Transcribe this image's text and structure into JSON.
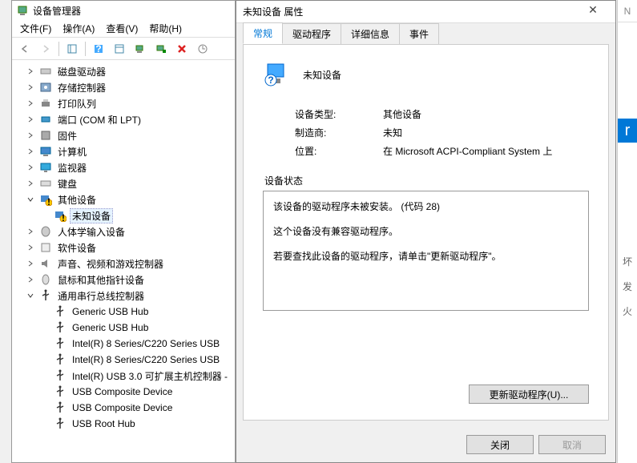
{
  "devmgr": {
    "title": "设备管理器",
    "menu": {
      "file": "文件(F)",
      "action": "操作(A)",
      "view": "查看(V)",
      "help": "帮助(H)"
    },
    "tree": [
      {
        "label": "磁盘驱动器",
        "icon": "disk-icon",
        "expander": ">",
        "indent": 1
      },
      {
        "label": "存储控制器",
        "icon": "storage-icon",
        "expander": ">",
        "indent": 1
      },
      {
        "label": "打印队列",
        "icon": "printer-icon",
        "expander": ">",
        "indent": 1
      },
      {
        "label": "端口 (COM 和 LPT)",
        "icon": "port-icon",
        "expander": ">",
        "indent": 1
      },
      {
        "label": "固件",
        "icon": "firmware-icon",
        "expander": ">",
        "indent": 1
      },
      {
        "label": "计算机",
        "icon": "computer-icon",
        "expander": ">",
        "indent": 1
      },
      {
        "label": "监视器",
        "icon": "monitor-icon",
        "expander": ">",
        "indent": 1
      },
      {
        "label": "键盘",
        "icon": "keyboard-icon",
        "expander": ">",
        "indent": 1
      },
      {
        "label": "其他设备",
        "icon": "othercat-icon",
        "expander": "v",
        "indent": 1
      },
      {
        "label": "未知设备",
        "icon": "unknown-icon",
        "expander": "",
        "indent": 2,
        "selected": true
      },
      {
        "label": "人体学输入设备",
        "icon": "hid-icon",
        "expander": ">",
        "indent": 1
      },
      {
        "label": "软件设备",
        "icon": "software-icon",
        "expander": ">",
        "indent": 1
      },
      {
        "label": "声音、视频和游戏控制器",
        "icon": "sound-icon",
        "expander": ">",
        "indent": 1
      },
      {
        "label": "鼠标和其他指针设备",
        "icon": "mouse-icon",
        "expander": ">",
        "indent": 1
      },
      {
        "label": "通用串行总线控制器",
        "icon": "usb-icon",
        "expander": "v",
        "indent": 1
      },
      {
        "label": "Generic USB Hub",
        "icon": "usbd-icon",
        "expander": "",
        "indent": 2
      },
      {
        "label": "Generic USB Hub",
        "icon": "usbd-icon",
        "expander": "",
        "indent": 2
      },
      {
        "label": "Intel(R) 8 Series/C220 Series USB",
        "icon": "usbd-icon",
        "expander": "",
        "indent": 2
      },
      {
        "label": "Intel(R) 8 Series/C220 Series USB",
        "icon": "usbd-icon",
        "expander": "",
        "indent": 2
      },
      {
        "label": "Intel(R) USB 3.0 可扩展主机控制器 -",
        "icon": "usbd-icon",
        "expander": "",
        "indent": 2
      },
      {
        "label": "USB Composite Device",
        "icon": "usbd-icon",
        "expander": "",
        "indent": 2
      },
      {
        "label": "USB Composite Device",
        "icon": "usbd-icon",
        "expander": "",
        "indent": 2
      },
      {
        "label": "USB Root Hub",
        "icon": "usbd-icon",
        "expander": "",
        "indent": 2
      }
    ]
  },
  "prop": {
    "title": "未知设备 属性",
    "tabs": {
      "general": "常规",
      "driver": "驱动程序",
      "details": "详细信息",
      "events": "事件"
    },
    "device_name": "未知设备",
    "rows": {
      "type_label": "设备类型:",
      "type_value": "其他设备",
      "mfg_label": "制造商:",
      "mfg_value": "未知",
      "loc_label": "位置:",
      "loc_value": "在 Microsoft ACPI-Compliant System 上"
    },
    "status_label": "设备状态",
    "status_lines": [
      "该设备的驱动程序未被安装。 (代码 28)",
      "这个设备没有兼容驱动程序。",
      "若要查找此设备的驱动程序，请单击\"更新驱动程序\"。"
    ],
    "update_btn": "更新驱动程序(U)...",
    "close_btn": "关闭",
    "cancel_btn": "取消"
  }
}
